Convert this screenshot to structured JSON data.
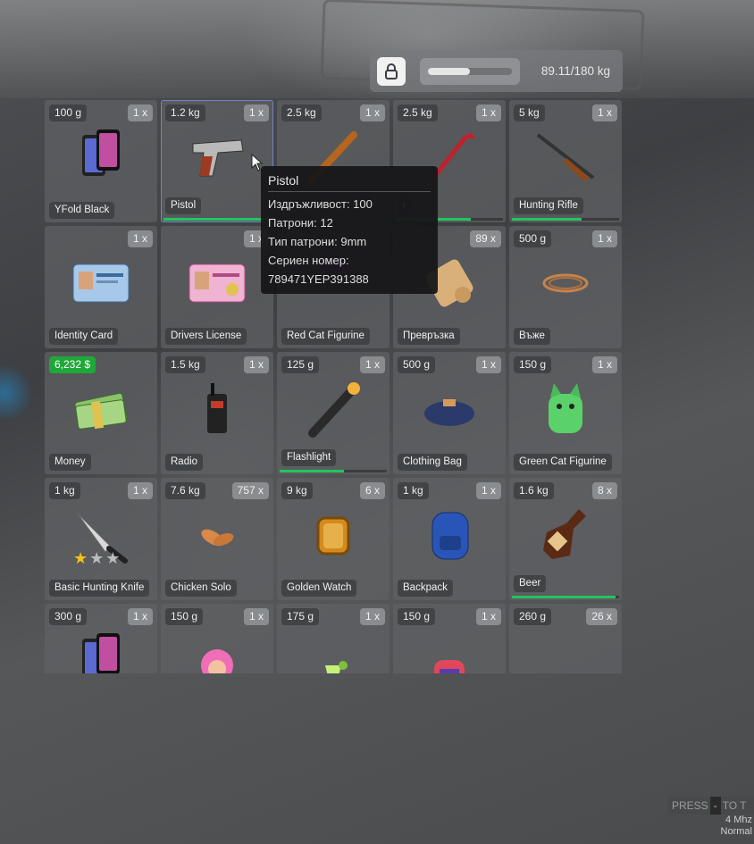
{
  "weight_panel": {
    "lock_icon": "lock-icon",
    "fill_fraction": 0.495,
    "text": "89.11/180 kg"
  },
  "slots": [
    {
      "weight": "100 g",
      "count": "1 x",
      "label": "YFold Black",
      "icon": "phone-icon"
    },
    {
      "weight": "1.2 kg",
      "count": "1 x",
      "label": "Pistol",
      "icon": "pistol-icon",
      "durability": 1.0,
      "active": true
    },
    {
      "weight": "2.5 kg",
      "count": "1 x",
      "label": "",
      "icon": "bat-icon"
    },
    {
      "weight": "2.5 kg",
      "count": "1 x",
      "label": "r",
      "icon": "crowbar-icon",
      "durability": 0.7
    },
    {
      "weight": "5 kg",
      "count": "1 x",
      "label": "Hunting Rifle",
      "icon": "rifle-icon",
      "durability": 0.65
    },
    {
      "weight": "",
      "count": "1 x",
      "label": "Identity Card",
      "icon": "id-card-icon"
    },
    {
      "weight": "",
      "count": "1 x",
      "label": "Drivers License",
      "icon": "license-icon"
    },
    {
      "weight": "",
      "count": "",
      "label": "Red Cat Figurine",
      "icon": "cat-figurine-icon"
    },
    {
      "weight": "",
      "count": "89 x",
      "label": "Превръзка",
      "icon": "bandage-icon"
    },
    {
      "weight": "500 g",
      "count": "1 x",
      "label": "Въже",
      "icon": "rope-icon"
    },
    {
      "weight": "6,232 $",
      "count": "",
      "label": "Money",
      "icon": "money-icon",
      "money": true
    },
    {
      "weight": "1.5 kg",
      "count": "1 x",
      "label": "Radio",
      "icon": "radio-icon"
    },
    {
      "weight": "125 g",
      "count": "1 x",
      "label": "Flashlight",
      "icon": "flashlight-icon",
      "durability": 0.6
    },
    {
      "weight": "500 g",
      "count": "1 x",
      "label": "Clothing Bag",
      "icon": "bag-icon"
    },
    {
      "weight": "150 g",
      "count": "1 x",
      "label": "Green Cat Figurine",
      "icon": "green-cat-icon"
    },
    {
      "weight": "1 kg",
      "count": "1 x",
      "label": "Basic Hunting Knife",
      "icon": "knife-icon",
      "stars": 1
    },
    {
      "weight": "7.6 kg",
      "count": "757 x",
      "label": "Chicken Solo",
      "icon": "chicken-icon"
    },
    {
      "weight": "9 kg",
      "count": "6 x",
      "label": "Golden Watch",
      "icon": "watch-icon"
    },
    {
      "weight": "1 kg",
      "count": "1 x",
      "label": "Backpack",
      "icon": "backpack-icon"
    },
    {
      "weight": "1.6 kg",
      "count": "8 x",
      "label": "Beer",
      "icon": "beer-icon",
      "durability": 0.97
    },
    {
      "weight": "300 g",
      "count": "1 x",
      "label": "",
      "icon": "phone-icon"
    },
    {
      "weight": "150 g",
      "count": "1 x",
      "label": "",
      "icon": "pink-figurine-icon"
    },
    {
      "weight": "175 g",
      "count": "1 x",
      "label": "",
      "icon": "cocktail-icon"
    },
    {
      "weight": "150 g",
      "count": "1 x",
      "label": "",
      "icon": "red-cat-icon"
    },
    {
      "weight": "260 g",
      "count": "26 x",
      "label": "",
      "icon": "cup-icon"
    }
  ],
  "tooltip": {
    "title": "Pistol",
    "lines": [
      "Издръжливост: 100",
      "Патрони: 12",
      "Тип патрони: 9mm",
      "Сериен номер:",
      "789471YEP391388"
    ]
  },
  "hint": {
    "press": "PRESS",
    "key": "-",
    "rest": "TO T",
    "line2": "4 Mhz",
    "line3": "Normal"
  },
  "colors": {
    "accent_green": "#22c55e",
    "money_badge": "#1fa83a",
    "active_outline": "#6f86c8"
  }
}
